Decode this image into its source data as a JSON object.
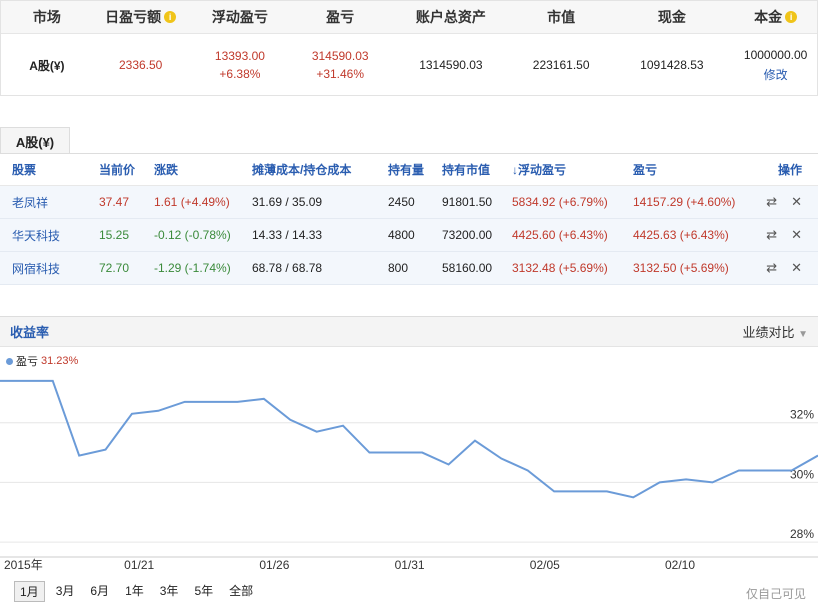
{
  "summary": {
    "headers": [
      "市场",
      "日盈亏额",
      "浮动盈亏",
      "盈亏",
      "账户总资产",
      "市值",
      "现金",
      "本金"
    ],
    "row": {
      "market": "A股(¥)",
      "daily_pl": "2336.50",
      "float_pl": "13393.00",
      "float_pl_pct": "+6.38%",
      "pl": "314590.03",
      "pl_pct": "+31.46%",
      "total_assets": "1314590.03",
      "market_value": "223161.50",
      "cash": "1091428.53",
      "principal": "1000000.00",
      "modify_label": "修改"
    }
  },
  "tab_label": "A股(¥)",
  "holdings": {
    "headers": [
      "股票",
      "当前价",
      "涨跌",
      "摊薄成本/持仓成本",
      "持有量",
      "持有市值",
      "浮动盈亏",
      "盈亏",
      "操作"
    ],
    "rows": [
      {
        "name": "老凤祥",
        "price": "37.47",
        "change": "1.61 (+4.49%)",
        "cost": "31.69 / 35.09",
        "qty": "2450",
        "value": "91801.50",
        "float_pl": "5834.92 (+6.79%)",
        "pl": "14157.29 (+4.60%)",
        "dir": "up"
      },
      {
        "name": "华天科技",
        "price": "15.25",
        "change": "-0.12 (-0.78%)",
        "cost": "14.33 / 14.33",
        "qty": "4800",
        "value": "73200.00",
        "float_pl": "4425.60 (+6.43%)",
        "pl": "4425.63 (+6.43%)",
        "dir": "down"
      },
      {
        "name": "网宿科技",
        "price": "72.70",
        "change": "-1.29 (-1.74%)",
        "cost": "68.78 / 68.78",
        "qty": "800",
        "value": "58160.00",
        "float_pl": "3132.48 (+5.69%)",
        "pl": "3132.50 (+5.69%)",
        "dir": "down"
      }
    ]
  },
  "chart": {
    "title": "收益率",
    "compare_label": "业绩对比",
    "legend_name": "盈亏",
    "legend_value": "31.23%",
    "ranges": [
      "1月",
      "3月",
      "6月",
      "1年",
      "3年",
      "5年",
      "全部"
    ],
    "active_range": "1月",
    "self_visible": "仅自己可见"
  },
  "chart_data": {
    "type": "line",
    "x_ticks": [
      "2015年",
      "01/21",
      "01/26",
      "01/31",
      "02/05",
      "02/10"
    ],
    "y_ticks": [
      "32%",
      "30%",
      "28%"
    ],
    "ylim": [
      27.5,
      33.8
    ],
    "series": [
      {
        "name": "盈亏",
        "values": [
          33.4,
          33.4,
          33.4,
          30.9,
          31.1,
          32.3,
          32.4,
          32.7,
          32.7,
          32.7,
          32.8,
          32.1,
          31.7,
          31.9,
          31.0,
          31.0,
          31.0,
          30.6,
          31.4,
          30.8,
          30.4,
          29.7,
          29.7,
          29.7,
          29.5,
          30.0,
          30.1,
          30.0,
          30.4,
          30.4,
          30.4,
          30.9
        ],
        "color": "#6b9bd8"
      }
    ]
  }
}
